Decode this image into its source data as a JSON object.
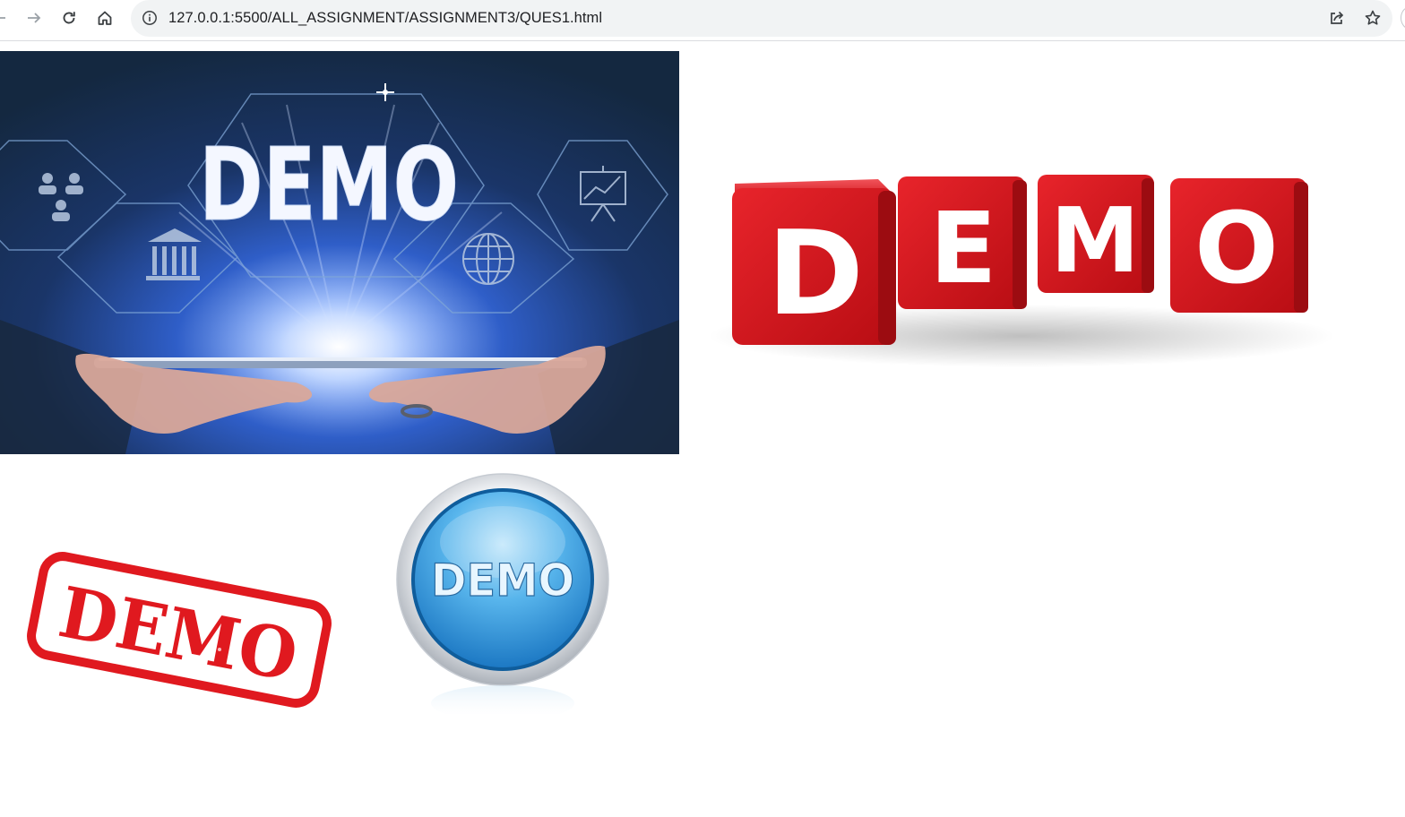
{
  "browser": {
    "url": "127.0.0.1:5500/ALL_ASSIGNMENT/ASSIGNMENT3/QUES1.html",
    "icons": {
      "back": "arrow-left-icon",
      "forward": "arrow-right-icon",
      "reload": "reload-icon",
      "home": "home-icon",
      "site_info": "info-icon",
      "share": "share-icon",
      "bookmark": "star-icon"
    }
  },
  "images": [
    {
      "name": "tablet-demo-image",
      "text": "DEMO"
    },
    {
      "name": "red-cubes-demo-image",
      "letters": [
        "D",
        "E",
        "M",
        "O"
      ]
    },
    {
      "name": "stamp-demo-image",
      "text": "DEMO",
      "color": "#e0191f"
    },
    {
      "name": "button-demo-image",
      "text": "DEMO",
      "color": "#2f9fe0"
    }
  ]
}
